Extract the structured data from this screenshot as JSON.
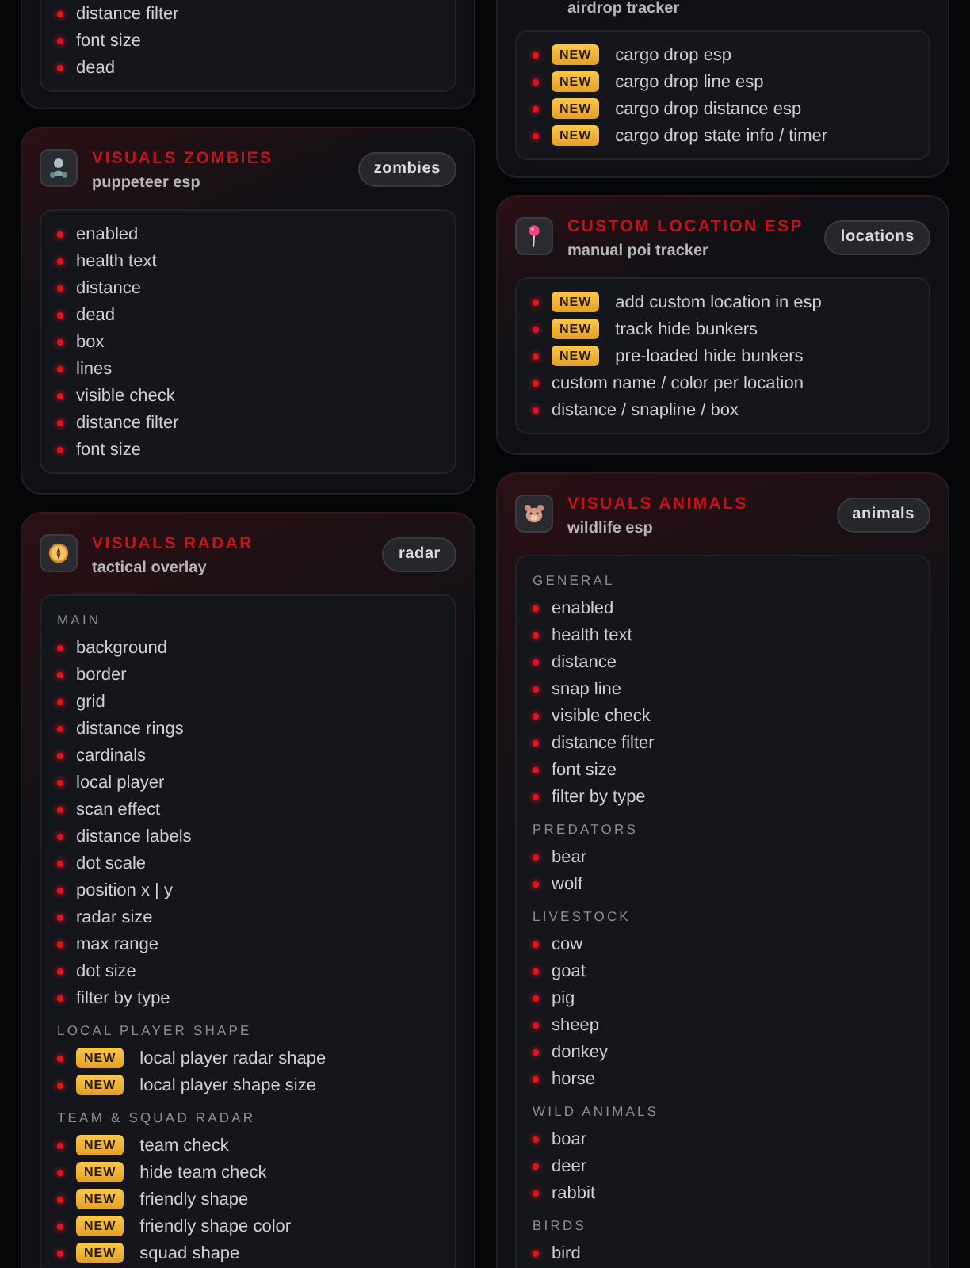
{
  "columns": [
    {
      "cards": [
        {
          "sections": [
            {
              "items": [
                {
                  "label": "distance filter"
                },
                {
                  "label": "font size"
                },
                {
                  "label": "dead"
                }
              ]
            }
          ]
        },
        {
          "kind": "zombies",
          "title": "VISUALS ZOMBIES",
          "subtitle": "puppeteer esp",
          "badge": "zombies",
          "sections": [
            {
              "items": [
                {
                  "label": "enabled"
                },
                {
                  "label": "health text"
                },
                {
                  "label": "distance"
                },
                {
                  "label": "dead"
                },
                {
                  "label": "box"
                },
                {
                  "label": "lines"
                },
                {
                  "label": "visible check"
                },
                {
                  "label": "distance filter"
                },
                {
                  "label": "font size"
                }
              ]
            }
          ]
        },
        {
          "kind": "radar",
          "title": "VISUALS RADAR",
          "subtitle": "tactical overlay",
          "badge": "radar",
          "sections": [
            {
              "heading": "MAIN",
              "items": [
                {
                  "label": "background"
                },
                {
                  "label": "border"
                },
                {
                  "label": "grid"
                },
                {
                  "label": "distance rings"
                },
                {
                  "label": "cardinals"
                },
                {
                  "label": "local player"
                },
                {
                  "label": "scan effect"
                },
                {
                  "label": "distance labels"
                },
                {
                  "label": "dot scale"
                },
                {
                  "label": "position x | y"
                },
                {
                  "label": "radar size"
                },
                {
                  "label": "max range"
                },
                {
                  "label": "dot size"
                },
                {
                  "label": "filter by type"
                }
              ]
            },
            {
              "heading": "LOCAL PLAYER SHAPE",
              "items": [
                {
                  "tag": "NEW",
                  "label": "local player radar shape"
                },
                {
                  "tag": "NEW",
                  "label": "local player shape size"
                }
              ]
            },
            {
              "heading": "TEAM & SQUAD RADAR",
              "items": [
                {
                  "tag": "NEW",
                  "label": "team check"
                },
                {
                  "tag": "NEW",
                  "label": "hide team check"
                },
                {
                  "tag": "NEW",
                  "label": "friendly shape"
                },
                {
                  "tag": "NEW",
                  "label": "friendly shape color"
                },
                {
                  "tag": "NEW",
                  "label": "squad shape"
                }
              ]
            }
          ]
        }
      ]
    },
    {
      "cards": [
        {
          "subtitle": "airdrop tracker",
          "sections": [
            {
              "items": [
                {
                  "tag": "NEW",
                  "label": "cargo drop esp"
                },
                {
                  "tag": "NEW",
                  "label": "cargo drop line esp"
                },
                {
                  "tag": "NEW",
                  "label": "cargo drop distance esp"
                },
                {
                  "tag": "NEW",
                  "label": "cargo drop state info / timer"
                }
              ]
            }
          ]
        },
        {
          "kind": "location",
          "title": "CUSTOM LOCATION ESP",
          "subtitle": "manual poi tracker",
          "badge": "locations",
          "sections": [
            {
              "items": [
                {
                  "tag": "NEW",
                  "label": "add custom location in esp"
                },
                {
                  "tag": "NEW",
                  "label": "track hide bunkers"
                },
                {
                  "tag": "NEW",
                  "label": "pre-loaded hide bunkers"
                },
                {
                  "label": "custom name / color per location"
                },
                {
                  "label": "distance / snapline / box"
                }
              ]
            }
          ]
        },
        {
          "kind": "animals",
          "title": "VISUALS ANIMALS",
          "subtitle": "wildlife esp",
          "badge": "animals",
          "sections": [
            {
              "heading": "GENERAL",
              "items": [
                {
                  "label": "enabled"
                },
                {
                  "label": "health text"
                },
                {
                  "label": "distance"
                },
                {
                  "label": "snap line"
                },
                {
                  "label": "visible check"
                },
                {
                  "label": "distance filter"
                },
                {
                  "label": "font size"
                },
                {
                  "label": "filter by type"
                }
              ]
            },
            {
              "heading": "PREDATORS",
              "items": [
                {
                  "label": "bear"
                },
                {
                  "label": "wolf"
                }
              ]
            },
            {
              "heading": "LIVESTOCK",
              "items": [
                {
                  "label": "cow"
                },
                {
                  "label": "goat"
                },
                {
                  "label": "pig"
                },
                {
                  "label": "sheep"
                },
                {
                  "label": "donkey"
                },
                {
                  "label": "horse"
                }
              ]
            },
            {
              "heading": "WILD ANIMALS",
              "items": [
                {
                  "label": "boar"
                },
                {
                  "label": "deer"
                },
                {
                  "label": "rabbit"
                }
              ]
            },
            {
              "heading": "BIRDS",
              "items": [
                {
                  "label": "bird"
                }
              ]
            }
          ]
        }
      ]
    }
  ]
}
